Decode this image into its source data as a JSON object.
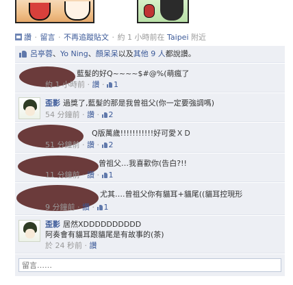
{
  "actions": {
    "share": "讚",
    "comment": "留言",
    "unfollow": "不再追蹤貼文",
    "time": "約 1 小時前在",
    "location": "Taipei",
    "near": "附近"
  },
  "likes": {
    "names": [
      "呂亭蓉",
      "Yo Ning",
      "顏呆呆"
    ],
    "sep1": "、",
    "sep2": "、",
    "and_text": "以及",
    "others": "其他 9 人",
    "suffix": "都說讚。"
  },
  "comments": [
    {
      "author": "",
      "text": "藍髮的好Q~~~~$#@%(萌瘋了",
      "time": "約 1 小時前",
      "like_label": "讚",
      "likes": "1"
    },
    {
      "author": "歪影",
      "text": "過獎了,藍髮的那是我曾祖父(你一定要強調嗎)",
      "time": "54 分鐘前",
      "like_label": "讚",
      "likes": "2"
    },
    {
      "author": "",
      "text": "Q版萬歲!!!!!!!!!!!好可愛ＸＤ",
      "time": "51 分鐘前",
      "like_label": "讚",
      "likes": "2"
    },
    {
      "author": "",
      "text": "曾祖父…我喜歡你(告白?!!",
      "time": "11 分鐘前",
      "like_label": "讚",
      "likes": "1"
    },
    {
      "author": "",
      "text": "尤其….曾祖父你有貓耳+貓尾((貓耳控現形",
      "time": "9 分鐘前",
      "like_label": "讚",
      "likes": "1"
    },
    {
      "author": "歪影",
      "text": "居然XDDDDDDDDDD",
      "text2": "阿奏會有貓耳跟貓尾是有故事的(茶)",
      "time": "於 24 秒前",
      "like_label": "讚"
    }
  ],
  "comment_box": {
    "placeholder": "留言……"
  }
}
